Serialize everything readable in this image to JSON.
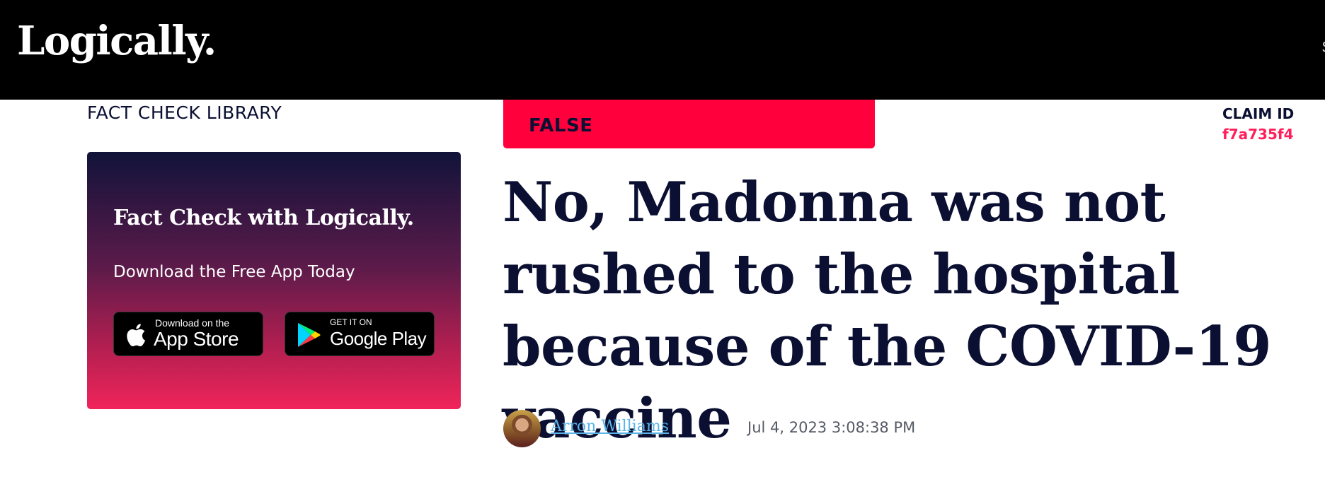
{
  "header": {
    "logo": "Logically.",
    "nav_peek": "S"
  },
  "sidebar": {
    "library_label": "FACT CHECK LIBRARY",
    "promo": {
      "title": "Fact Check with Logically.",
      "subtitle": "Download the Free App Today",
      "app_store": {
        "small": "Download on the",
        "big": "App Store",
        "icon": "apple-icon"
      },
      "google_play": {
        "small": "GET IT ON",
        "big": "Google Play",
        "icon": "google-play-icon"
      }
    }
  },
  "article": {
    "verdict": "FALSE",
    "claim_id_label": "CLAIM ID",
    "claim_id": "f7a735f4",
    "headline": "No, Madonna was not rushed to the hospital because of the COVID-19 vaccine",
    "author": "Arron Williams",
    "date": "Jul 4, 2023 3:08:38 PM"
  },
  "colors": {
    "topbar": "#000000",
    "verdict_false": "#ff003c",
    "claim_id": "#ff1f5a",
    "headline": "#0b1032",
    "author_link": "#5ab4e8"
  }
}
